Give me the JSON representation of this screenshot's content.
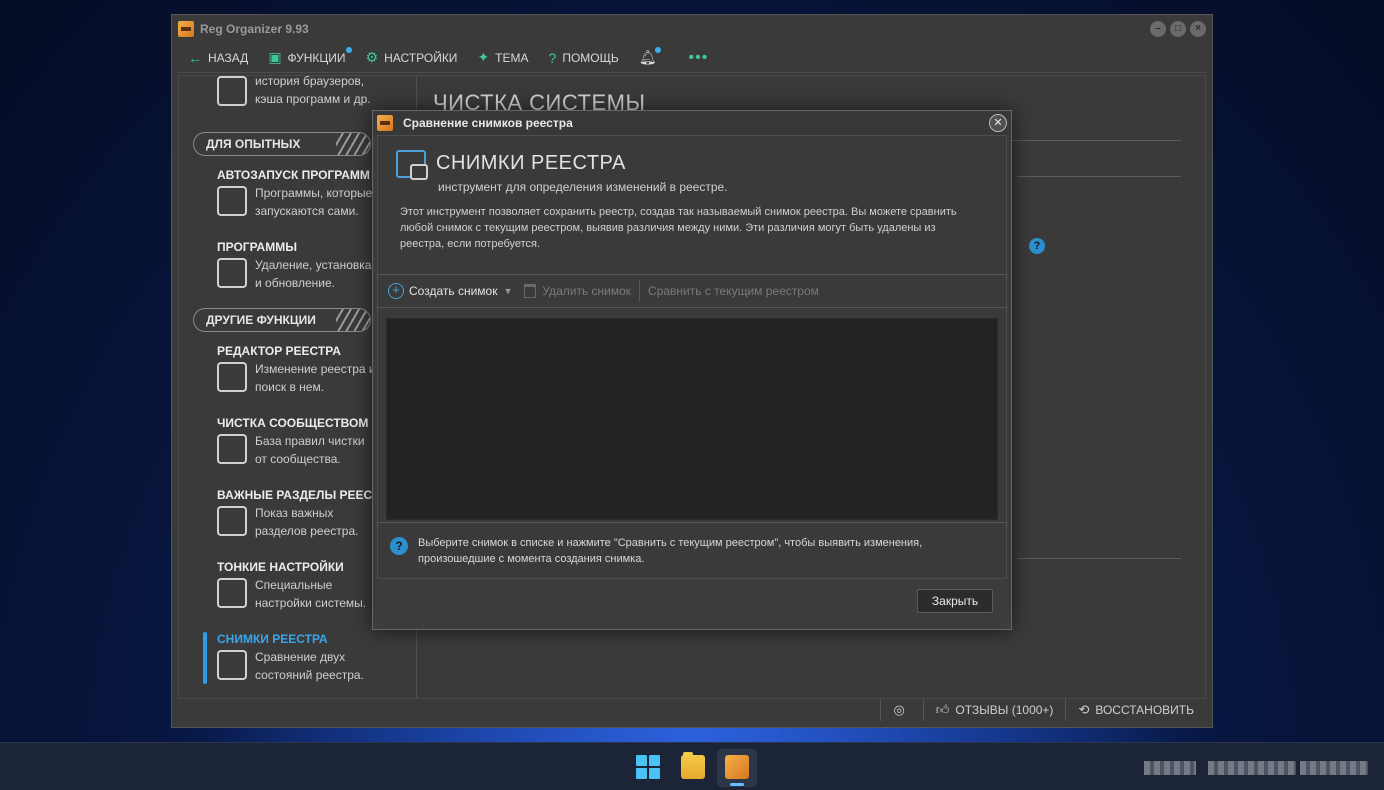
{
  "window": {
    "title": "Reg Organizer 9.93"
  },
  "toolbar": {
    "back": "НАЗАД",
    "functions": "ФУНКЦИИ",
    "settings": "НАСТРОЙКИ",
    "theme": "ТЕМА",
    "help": "ПОМОЩЬ",
    "more": "•••"
  },
  "sidebar": {
    "top_partial": {
      "line1": "история браузеров,",
      "line2": "кэша программ и др."
    },
    "section_advanced": "ДЛЯ ОПЫТНЫХ",
    "section_other": "ДРУГИЕ ФУНКЦИИ",
    "items": [
      {
        "title": "АВТОЗАПУСК ПРОГРАММ",
        "line1": "Программы, которые",
        "line2": "запускаются сами."
      },
      {
        "title": "ПРОГРАММЫ",
        "line1": "Удаление, установка",
        "line2": "и обновление."
      },
      {
        "title": "РЕДАКТОР РЕЕСТРА",
        "line1": "Изменение реестра и",
        "line2": "поиск в нем."
      },
      {
        "title": "ЧИСТКА СООБЩЕСТВОМ",
        "line1": "База правил чистки",
        "line2": "от сообщества."
      },
      {
        "title": "ВАЖНЫЕ РАЗДЕЛЫ РЕЕСТРА",
        "line1": "Показ важных",
        "line2": "разделов реестра."
      },
      {
        "title": "ТОНКИЕ НАСТРОЙКИ",
        "line1": "Специальные",
        "line2": "настройки системы."
      },
      {
        "title": "СНИМКИ РЕЕСТРА",
        "line1": "Сравнение двух",
        "line2": "состояний реестра."
      }
    ]
  },
  "main": {
    "heading": "ЧИСТКА СИСТЕМЫ"
  },
  "status_bar": {
    "reviews": "ОТЗЫВЫ (1000+)",
    "restore": "ВОССТАНОВИТЬ"
  },
  "dialog": {
    "title": "Сравнение снимков реестра",
    "heading": "СНИМКИ РЕЕСТРА",
    "subheading": "инструмент для определения изменений в реестре.",
    "description": "Этот инструмент позволяет сохранить реестр, создав так называемый снимок реестра. Вы можете сравнить любой снимок с текущим реестром, выявив различия между ними. Эти различия могут быть удалены из реестра, если потребуется.",
    "create_snapshot": "Создать снимок",
    "delete_snapshot": "Удалить снимок",
    "compare_current": "Сравнить с текущим реестром",
    "info_text": "Выберите снимок в списке и нажмите \"Сравнить с текущим реестром\", чтобы выявить изменения, произошедшие с момента создания снимка.",
    "close_button": "Закрыть"
  }
}
